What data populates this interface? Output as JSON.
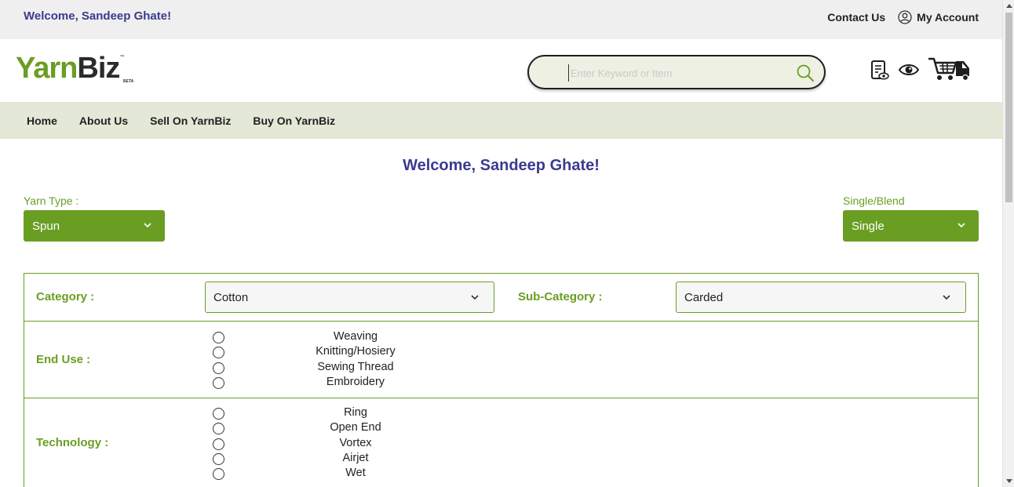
{
  "topbar": {
    "welcome": "Welcome, Sandeep Ghate!",
    "contact_label": "Contact Us",
    "account_label": "My Account"
  },
  "header": {
    "logo_part1": "Yarn",
    "logo_part2": "Biz",
    "logo_tm": "™",
    "logo_beta": "BETA",
    "search_placeholder": "Enter Keyword or Item",
    "search_value": ""
  },
  "nav": {
    "items": [
      {
        "label": "Home"
      },
      {
        "label": "About Us"
      },
      {
        "label": "Sell On YarnBiz"
      },
      {
        "label": "Buy On YarnBiz"
      }
    ]
  },
  "main": {
    "title": "Welcome, Sandeep Ghate!",
    "yarn_type": {
      "label": "Yarn Type :",
      "value": "Spun"
    },
    "single_blend": {
      "label": "Single/Blend",
      "value": "Single"
    },
    "category": {
      "label": "Category :",
      "value": "Cotton"
    },
    "sub_category": {
      "label": "Sub-Category :",
      "value": "Carded"
    },
    "end_use": {
      "label": "End Use :",
      "options": [
        "Weaving",
        "Knitting/Hosiery",
        "Sewing Thread",
        "Embroidery"
      ]
    },
    "technology": {
      "label": "Technology :",
      "options": [
        "Ring",
        "Open End",
        "Vortex",
        "Airjet",
        "Wet"
      ]
    }
  },
  "colors": {
    "brand_green": "#6a9e23",
    "brand_navy": "#3b3a8f",
    "nav_bg": "#e4e8d6"
  },
  "icons": {
    "account": "user-circle-icon",
    "search": "search-icon",
    "quotes": "document-eye-icon",
    "watchlist": "eye-icon",
    "cart": "cart-truck-icon",
    "dropdown": "chevron-down-icon"
  }
}
